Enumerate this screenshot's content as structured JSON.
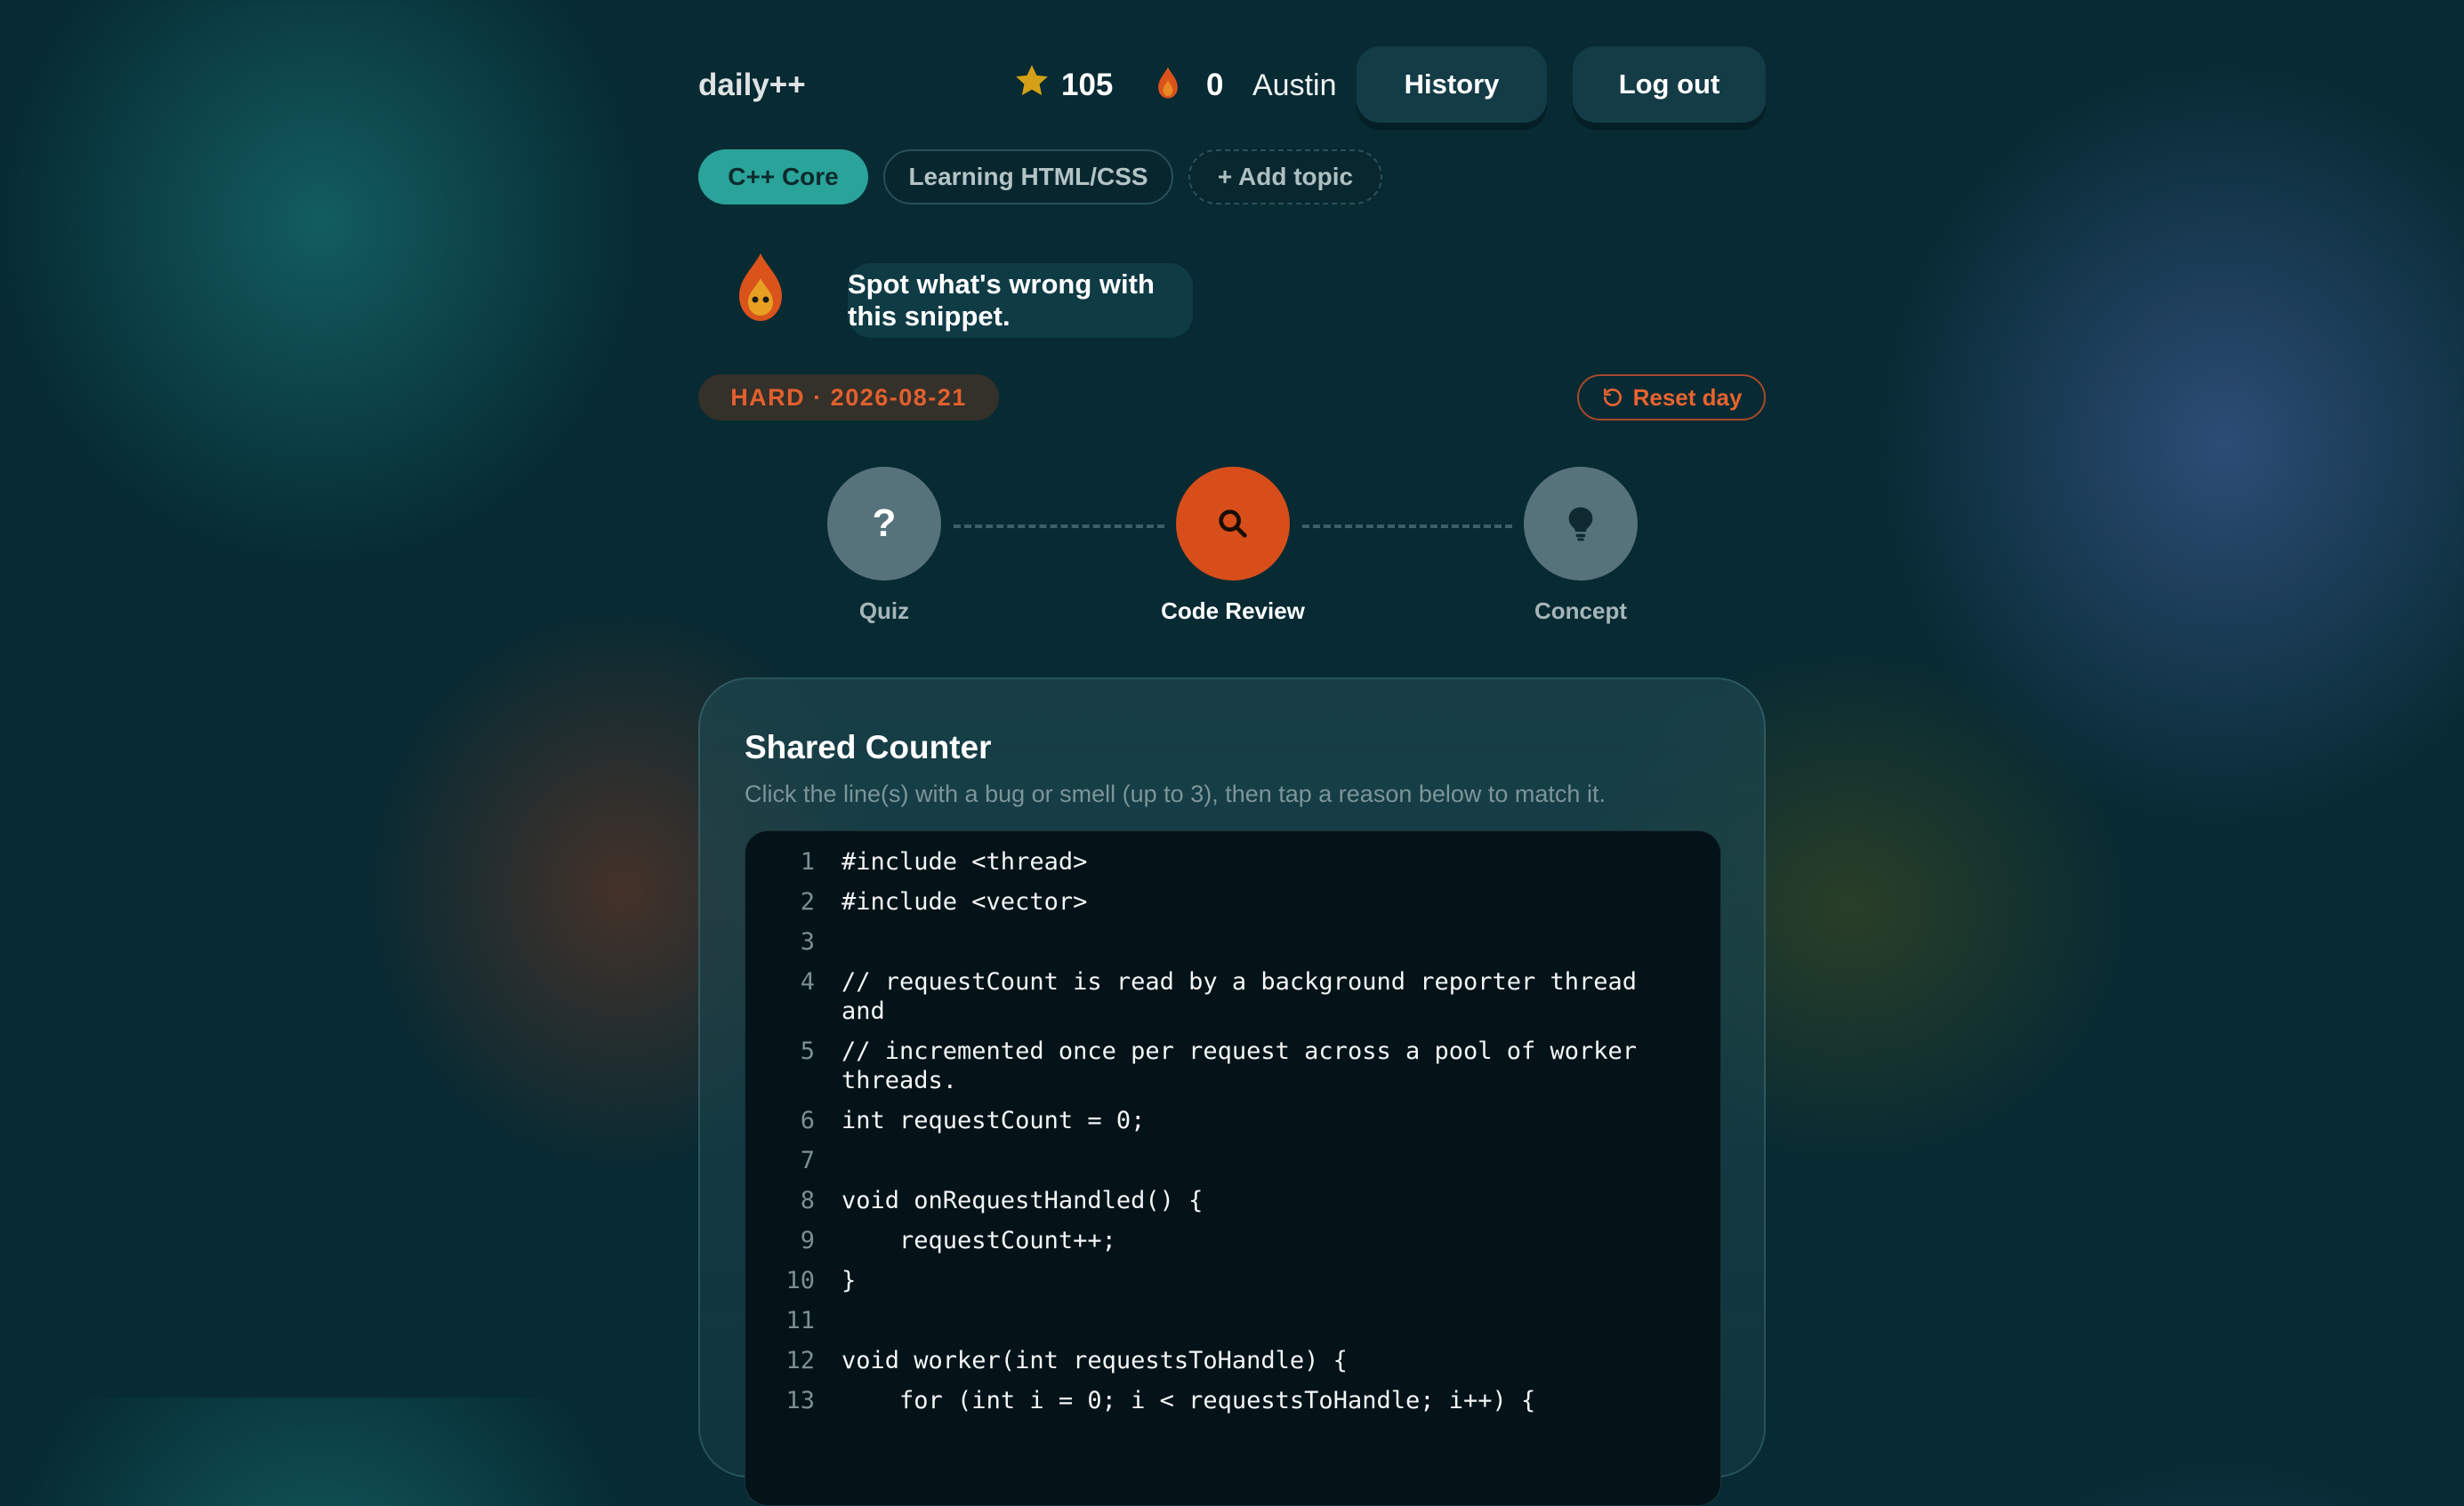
{
  "header": {
    "logo": "daily++",
    "points": "105",
    "streak": "0",
    "username": "Austin",
    "history_label": "History",
    "logout_label": "Log out",
    "star_color": "#d4a017",
    "flame_color": "#e05a1e"
  },
  "topics": [
    {
      "label": "C++ Core",
      "active": true
    },
    {
      "label": "Learning HTML/CSS",
      "active": false
    },
    {
      "label": "+ Add topic",
      "active": false
    }
  ],
  "mascot": {
    "icon": "flame-mascot-icon",
    "message": "Spot what's wrong with this snippet."
  },
  "difficulty_label": "HARD · 2026-08-21",
  "reset_label": "Reset day",
  "steps": [
    {
      "label": "Quiz",
      "icon": "question-mark-icon",
      "state": "inactive"
    },
    {
      "label": "Code Review",
      "icon": "search-icon",
      "state": "active"
    },
    {
      "label": "Concept",
      "icon": "lightbulb-icon",
      "state": "inactive"
    }
  ],
  "card": {
    "title": "Shared Counter",
    "instructions": "Click the line(s) with a bug or smell (up to 3), then tap a reason below to match it.",
    "code_lines": [
      {
        "n": "1",
        "text": "#include <thread>"
      },
      {
        "n": "2",
        "text": "#include <vector>"
      },
      {
        "n": "3",
        "text": ""
      },
      {
        "n": "4",
        "text": "// requestCount is read by a background reporter thread and"
      },
      {
        "n": "5",
        "text": "// incremented once per request across a pool of worker threads."
      },
      {
        "n": "6",
        "text": "int requestCount = 0;"
      },
      {
        "n": "7",
        "text": ""
      },
      {
        "n": "8",
        "text": "void onRequestHandled() {"
      },
      {
        "n": "9",
        "text": "    requestCount++;"
      },
      {
        "n": "10",
        "text": "}"
      },
      {
        "n": "11",
        "text": ""
      },
      {
        "n": "12",
        "text": "void worker(int requestsToHandle) {"
      },
      {
        "n": "13",
        "text": "    for (int i = 0; i < requestsToHandle; i++) {"
      }
    ]
  },
  "colors": {
    "accent_teal": "#2aa39a",
    "accent_orange": "#d74e1a",
    "background": "#072a33"
  }
}
